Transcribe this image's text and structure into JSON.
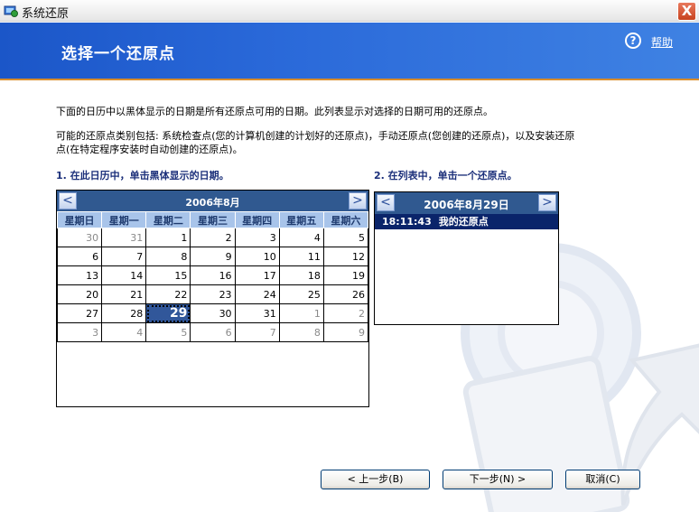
{
  "window": {
    "title": "系统还原",
    "close_label": "X"
  },
  "header": {
    "title": "选择一个还原点",
    "help_label": "帮助",
    "help_icon": "?"
  },
  "intro": {
    "para1": "下面的日历中以黑体显示的日期是所有还原点可用的日期。此列表显示对选择的日期可用的还原点。",
    "para2": "可能的还原点类别包括: 系统检查点(您的计算机创建的计划好的还原点)，手动还原点(您创建的还原点)，以及安装还原点(在特定程序安装时自动创建的还原点)。"
  },
  "step1": "1. 在此日历中，单击黑体显示的日期。",
  "step2": "2. 在列表中，单击一个还原点。",
  "calendar": {
    "month": "2006年8月",
    "prev": "<",
    "next": ">",
    "weekdays": [
      "星期日",
      "星期一",
      "星期二",
      "星期三",
      "星期四",
      "星期五",
      "星期六"
    ],
    "weeks": [
      [
        {
          "d": "30",
          "o": true
        },
        {
          "d": "31",
          "o": true
        },
        {
          "d": "1"
        },
        {
          "d": "2"
        },
        {
          "d": "3"
        },
        {
          "d": "4"
        },
        {
          "d": "5"
        }
      ],
      [
        {
          "d": "6"
        },
        {
          "d": "7"
        },
        {
          "d": "8"
        },
        {
          "d": "9"
        },
        {
          "d": "10"
        },
        {
          "d": "11"
        },
        {
          "d": "12"
        }
      ],
      [
        {
          "d": "13"
        },
        {
          "d": "14"
        },
        {
          "d": "15"
        },
        {
          "d": "16"
        },
        {
          "d": "17"
        },
        {
          "d": "18"
        },
        {
          "d": "19"
        }
      ],
      [
        {
          "d": "20"
        },
        {
          "d": "21"
        },
        {
          "d": "22"
        },
        {
          "d": "23"
        },
        {
          "d": "24"
        },
        {
          "d": "25"
        },
        {
          "d": "26"
        }
      ],
      [
        {
          "d": "27"
        },
        {
          "d": "28"
        },
        {
          "d": "29",
          "sel": true
        },
        {
          "d": "30"
        },
        {
          "d": "31"
        },
        {
          "d": "1",
          "o": true
        },
        {
          "d": "2",
          "o": true
        }
      ],
      [
        {
          "d": "3",
          "o": true
        },
        {
          "d": "4",
          "o": true
        },
        {
          "d": "5",
          "o": true
        },
        {
          "d": "6",
          "o": true
        },
        {
          "d": "7",
          "o": true
        },
        {
          "d": "8",
          "o": true
        },
        {
          "d": "9",
          "o": true
        }
      ]
    ]
  },
  "restore_list": {
    "date": "2006年8月29日",
    "prev": "<",
    "next": ">",
    "items": [
      {
        "time": "18:11:43",
        "name": "我的还原点"
      }
    ]
  },
  "buttons": {
    "back": "< 上一步(B)",
    "next": "下一步(N) >",
    "cancel": "取消(C)"
  },
  "colors": {
    "header_blue": "#2a69d9",
    "calendar_header": "#305990",
    "selection": "#0a246a",
    "accent_rule": "#d98d2c"
  }
}
